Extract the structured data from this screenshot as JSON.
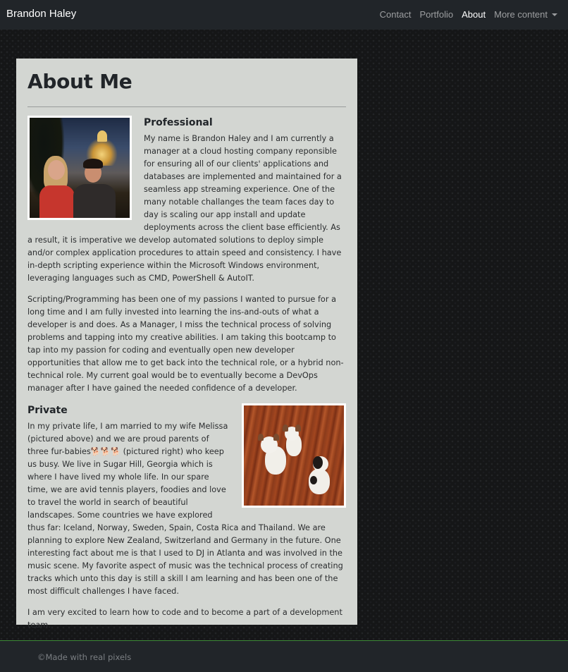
{
  "navbar": {
    "brand": "Brandon Haley",
    "links": [
      {
        "label": "Contact",
        "active": false
      },
      {
        "label": "Portfolio",
        "active": false
      },
      {
        "label": "About",
        "active": true
      },
      {
        "label": "More content",
        "active": false,
        "dropdown": true
      }
    ]
  },
  "main": {
    "title": "About Me",
    "professional": {
      "heading": "Professional",
      "paragraphs": [
        "My name is Brandon Haley and I am currently a manager at a cloud hosting company reponsible for ensuring all of our clients' applications and databases are implemented and maintained for a seamless app streaming experience. One of the many notable challanges the team faces day to day is scaling our app install and update deployments across the client base efficiently. As a result, it is imperative we develop automated solutions to deploy simple and/or complex application procedures to attain speed and consistency. I have in-depth scripting experience within the Microsoft Windows environment, leveraging languages such as CMD, PowerShell & AutoIT.",
        "Scripting/Programming has been one of my passions I wanted to pursue for a long time and I am fully invested into learning the ins-and-outs of what a developer is and does. As a Manager, I miss the technical process of solving problems and tapping into my creative abilities. I am taking this bootcamp to tap into my passion for coding and eventually open new developer opportunities that allow me to get back into the technical role, or a hybrid non-technical role. My current goal would be to eventually become a DevOps manager after I have gained the needed confidence of a developer."
      ]
    },
    "private": {
      "heading": "Private",
      "paragraphs": [
        "In my private life, I am married to my wife Melissa (pictured above) and we are proud parents of three fur-babies🐕🐕🐕 (pictured right) who keep us busy. We live in Sugar Hill, Georgia which is where I have lived my whole life. In our spare time, we are avid tennis players, foodies and love to travel the world in search of beautiful landscapes. Some countries we have explored thus far: Iceland, Norway, Sweden, Spain, Costa Rica and Thailand. We are planning to explore New Zealand, Switzerland and Germany in the future. One interesting fact about me is that I used to DJ in Atlanta and was involved in the music scene. My favorite aspect of music was the technical process of creating tracks which unto this day is still a skill I am learning and has been one of the most difficult challenges I have faced.",
        "I am very excited to learn how to code and to become a part of a development team."
      ]
    }
  },
  "footer": {
    "text": "©Made with real pixels"
  },
  "colors": {
    "navbar_bg": "#212529",
    "card_bg": "#d3d6d2",
    "footer_accent": "#3d8b37"
  }
}
